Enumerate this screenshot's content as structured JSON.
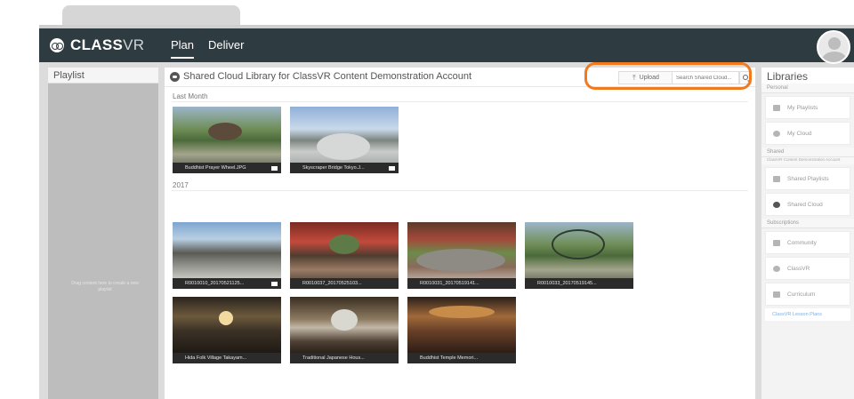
{
  "app": {
    "logo_class": "CLASS",
    "logo_vr": "VR",
    "nav": [
      "Plan",
      "Deliver"
    ]
  },
  "playlist": {
    "title": "Playlist",
    "hint": "Drag content here to create a new playlist"
  },
  "main": {
    "title": "Shared Cloud Library for ClassVR Content Demonstration Account",
    "upload_label": "Upload",
    "search_placeholder": "Search Shared Cloud...",
    "groups": [
      {
        "label": "Last Month",
        "items": [
          {
            "name": "Buddhist Prayer Wheel.JPG",
            "flag": true
          },
          {
            "name": "Skyscraper Bridge Tokyo.J...",
            "flag": true
          }
        ]
      },
      {
        "label": "2017",
        "items": [
          {
            "name": "R0010010_20170521125...",
            "flag": true
          },
          {
            "name": "R0010037_20170525103...",
            "flag": false
          },
          {
            "name": "R0010031_20170519141...",
            "flag": false
          },
          {
            "name": "R0010033_20170519145...",
            "flag": false
          },
          {
            "name": "Hida Folk Village Takayam...",
            "flag": false
          },
          {
            "name": "Traditional Japanese Hous...",
            "flag": false
          },
          {
            "name": "Buddhist Temple Memori...",
            "flag": false
          }
        ]
      }
    ]
  },
  "libraries": {
    "title": "Libraries",
    "personal_label": "Personal",
    "personal": [
      "My Playlists",
      "My Cloud"
    ],
    "shared_label": "Shared",
    "shared_sub": "ClassVR Content Demonstration Account",
    "shared": [
      "Shared Playlists",
      "Shared Cloud"
    ],
    "subscriptions_label": "Subscriptions",
    "subscriptions": [
      "Community",
      "ClassVR",
      "Curriculum"
    ],
    "link": "ClassVR Lesson Plans"
  }
}
